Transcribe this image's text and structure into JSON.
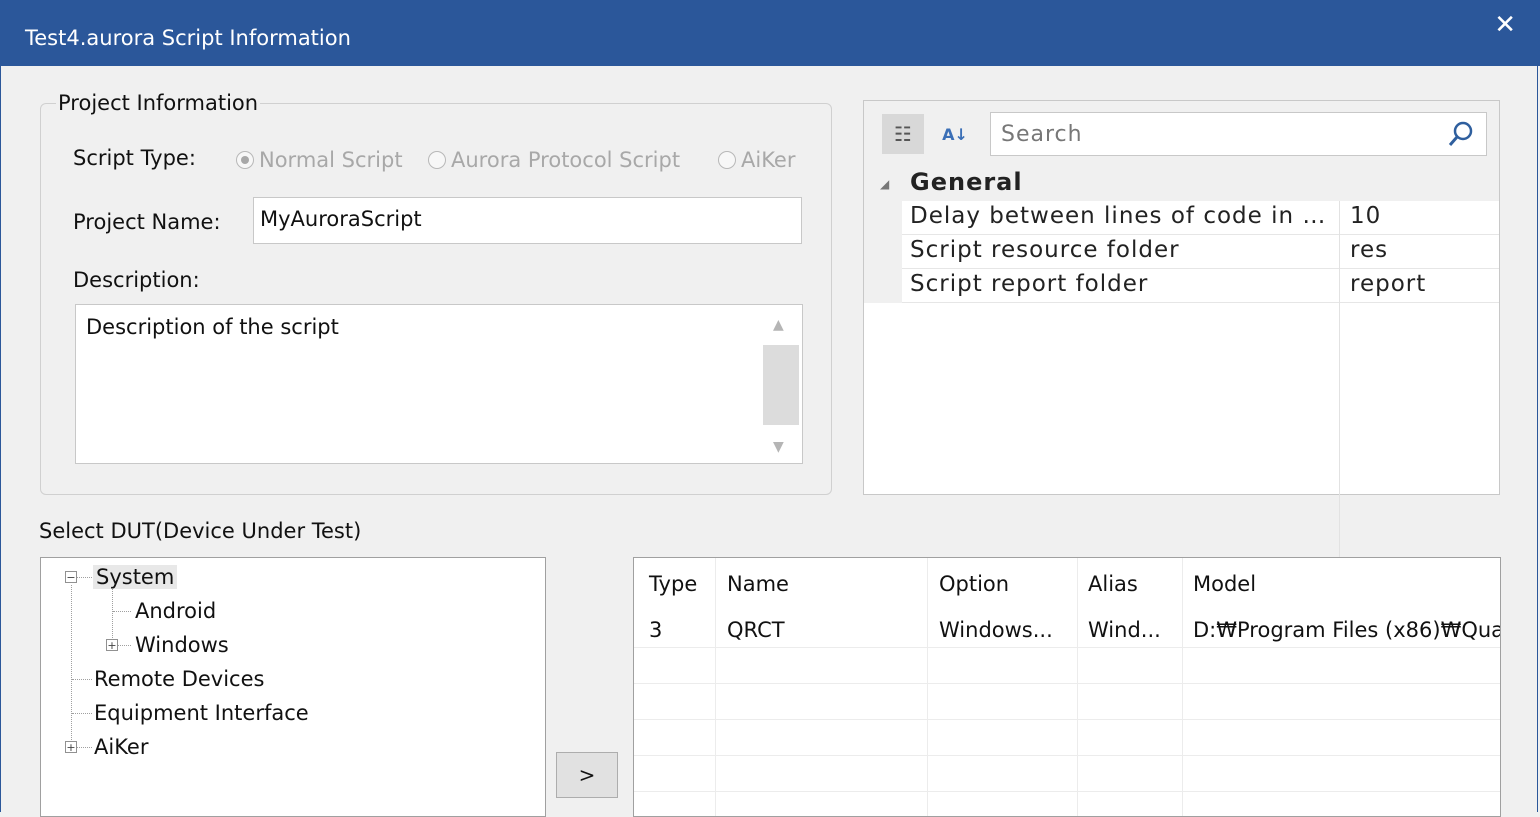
{
  "window": {
    "title": "Test4.aurora Script Information",
    "close_glyph": "✕"
  },
  "project": {
    "group_title": "Project Information",
    "script_type_label": "Script Type:",
    "script_types": [
      {
        "label": "Normal Script",
        "selected": true
      },
      {
        "label": "Aurora Protocol Script",
        "selected": false
      },
      {
        "label": "AiKer",
        "selected": false
      }
    ],
    "name_label": "Project Name:",
    "name_value": "MyAuroraScript",
    "description_label": "Description:",
    "description_value": "Description of the script"
  },
  "property_grid": {
    "search_placeholder": "Search",
    "category": "General",
    "rows": [
      {
        "key": "Delay between lines of code in s...",
        "value": "10"
      },
      {
        "key": "Script resource folder",
        "value": "res"
      },
      {
        "key": "Script report folder",
        "value": "report"
      }
    ]
  },
  "dut": {
    "label": "Select DUT(Device Under Test)",
    "tree": {
      "system": "System",
      "android": "Android",
      "windows": "Windows",
      "remote": "Remote Devices",
      "equipment": "Equipment Interface",
      "aiker": "AiKer"
    },
    "move_button": ">",
    "table": {
      "columns": [
        "Type",
        "Name",
        "Option",
        "Alias",
        "Model"
      ],
      "rows": [
        [
          "3",
          "QRCT",
          "Windows...",
          "Wind...",
          "D:₩Program Files (x86)₩Qua"
        ]
      ]
    }
  }
}
